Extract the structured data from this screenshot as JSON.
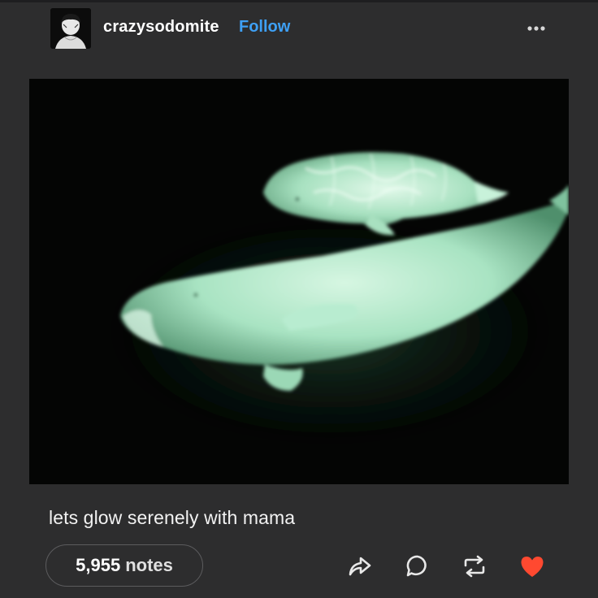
{
  "post": {
    "username": "crazysodomite",
    "follow_label": "Follow",
    "more_icon": "ellipsis-icon",
    "caption": "lets glow serenely with mama",
    "notes_count": "5,955",
    "notes_label": "notes",
    "actions": {
      "share_icon": "share-icon",
      "reply_icon": "reply-icon",
      "reblog_icon": "reblog-icon",
      "like_icon": "heart-icon"
    }
  },
  "colors": {
    "background": "#2d2d2e",
    "follow": "#3ea0f5",
    "like": "#ff4930",
    "media_glow": "#b9f0cf"
  }
}
